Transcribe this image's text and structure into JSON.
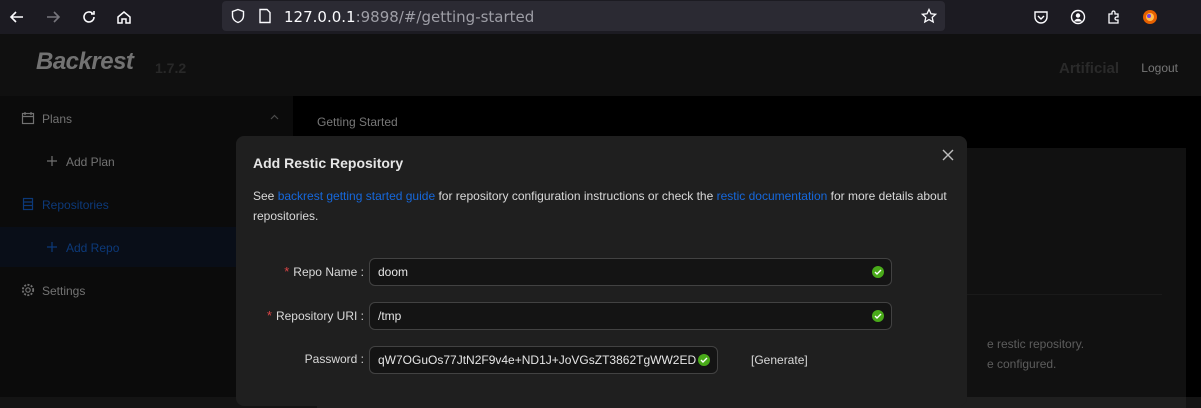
{
  "browser": {
    "url_host": "127.0.0.1",
    "url_rest": ":9898/#/getting-started"
  },
  "header": {
    "logo_text": "Backrest",
    "version": "1.7.2",
    "instance": "Artificial",
    "logout_label": "Logout"
  },
  "sidebar": {
    "items": [
      {
        "label": "Plans"
      },
      {
        "label": "Add Plan"
      },
      {
        "label": "Repositories"
      },
      {
        "label": "Add Repo"
      },
      {
        "label": "Settings"
      }
    ]
  },
  "main": {
    "breadcrumb": "Getting Started",
    "partial_text_1": "e restic repository.",
    "partial_text_2": "e configured."
  },
  "modal": {
    "title": "Add Restic Repository",
    "desc_prefix": "See ",
    "desc_link1": "backrest getting started guide",
    "desc_mid": " for repository configuration instructions or check the ",
    "desc_link2": "restic documentation",
    "desc_suffix": " for more details about repositories.",
    "fields": [
      {
        "label": "Repo Name",
        "value": "doom",
        "required": true
      },
      {
        "label": "Repository URI",
        "value": "/tmp",
        "required": true
      },
      {
        "label": "Password",
        "value": "qW7OGuOs77JtN2F9v4e+ND1J+JoVGsZT3862TgWW2ED",
        "required": false
      }
    ],
    "generate_label": "[Generate]"
  },
  "colors": {
    "accent": "#1668dc",
    "success": "#49aa19",
    "required": "#dc4446"
  }
}
